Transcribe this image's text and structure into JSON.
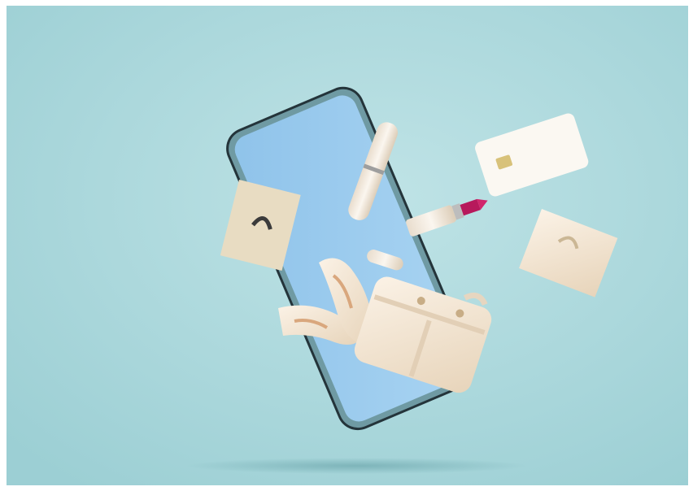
{
  "scene": {
    "subject": "smartphone-with-floating-shopping-items",
    "colors": {
      "background": "#a9d8dc",
      "phone_screen": "#9fcaec",
      "phone_frame": "#2c3a3e",
      "cream": "#f3e6d2",
      "lipstick": "#c2185b"
    }
  }
}
